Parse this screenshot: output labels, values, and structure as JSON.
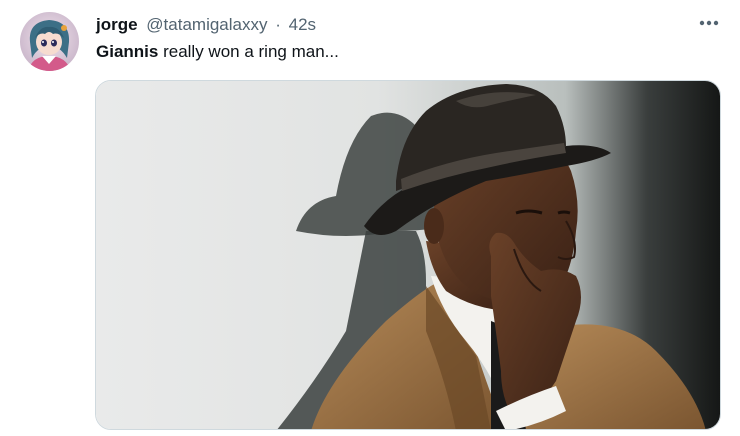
{
  "tweet": {
    "author_name": "jorge",
    "author_handle": "@tatamigalaxxy",
    "separator": "·",
    "time": "42s",
    "text_bold": "Giannis",
    "text_rest": " really won a ring man..."
  },
  "icons": {
    "more": "more-horizontal-icon"
  },
  "colors": {
    "text_primary": "#0f1419",
    "text_secondary": "#536471"
  }
}
